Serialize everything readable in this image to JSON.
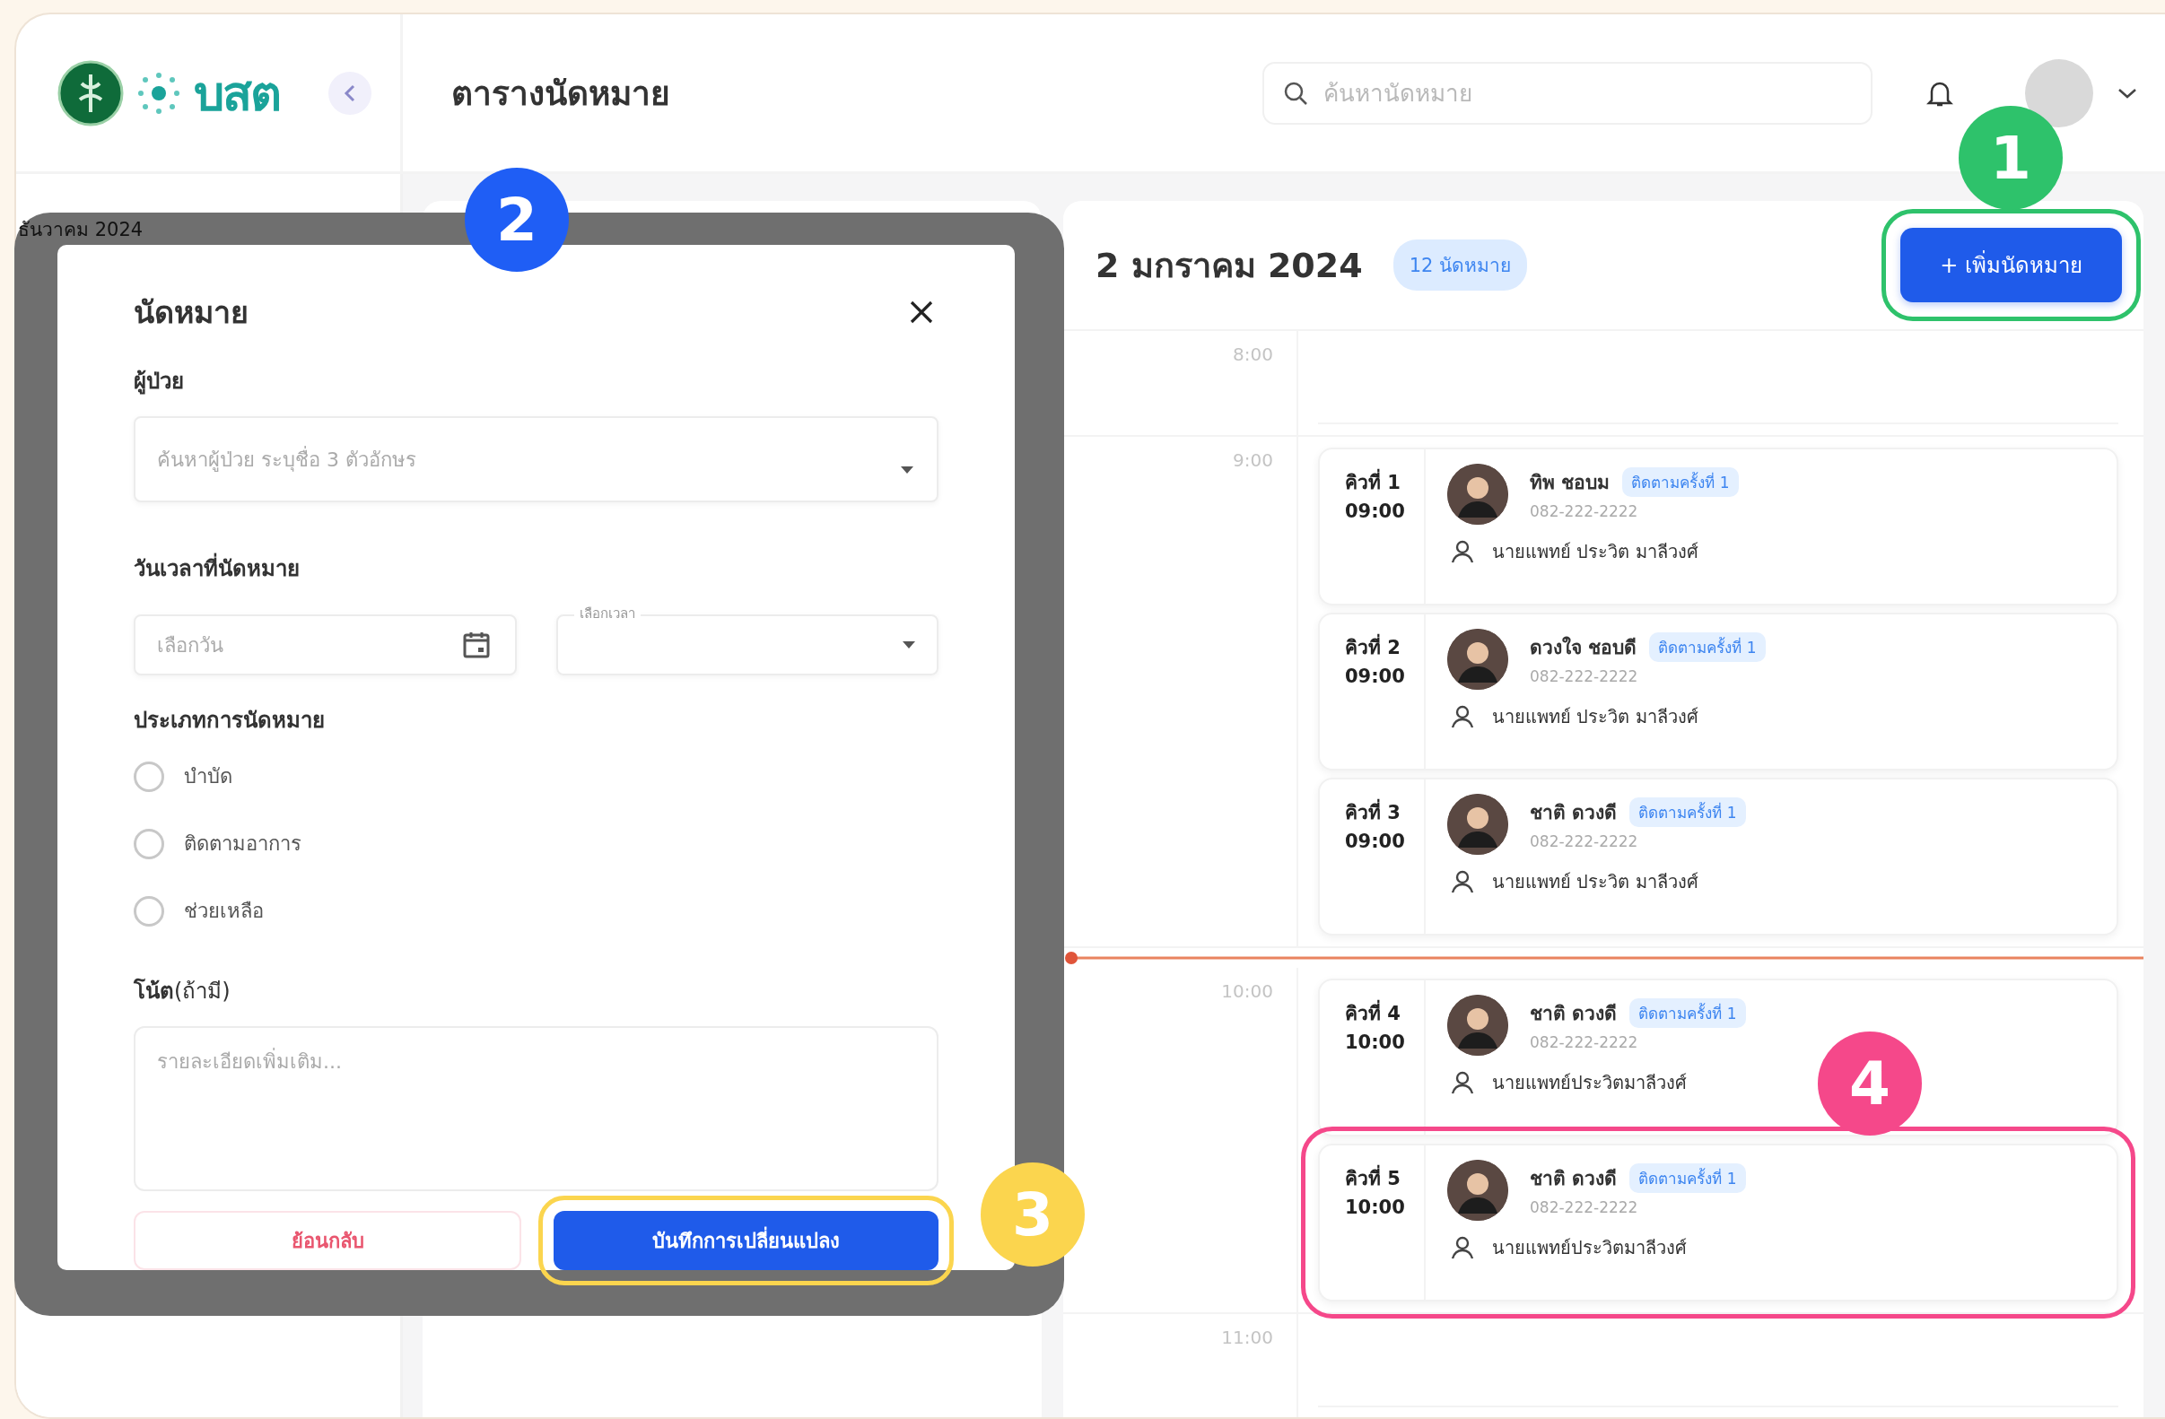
{
  "header": {
    "logo_text": "บสต",
    "page_title": "ตารางนัดหมาย",
    "search": {
      "placeholder": "ค้นหานัดหมาย"
    }
  },
  "sidebar": {
    "month_label": "ธันวาคม 2024"
  },
  "schedule": {
    "date": "2 มกราคม 2024",
    "count_badge": "12 นัดหมาย",
    "add_button": "+ เพิ่มนัดหมาย",
    "slots": [
      {
        "time": "8:00"
      },
      {
        "time": "9:00",
        "appointments": [
          {
            "queue": "คิวที่ 1",
            "time": "09:00",
            "patient": "ทิพ ชอบม",
            "tag": "ติดตามครั้งที่ 1",
            "phone": "082-222-2222",
            "doctor": "นายแพทย์ ประวิต มาลีวงศ์"
          },
          {
            "queue": "คิวที่ 2",
            "time": "09:00",
            "patient": "ดวงใจ ชอบดี",
            "tag": "ติดตามครั้งที่ 1",
            "phone": "082-222-2222",
            "doctor": "นายแพทย์ ประวิต มาลีวงศ์"
          },
          {
            "queue": "คิวที่ 3",
            "time": "09:00",
            "patient": "ชาติ ดวงดี",
            "tag": "ติดตามครั้งที่ 1",
            "phone": "082-222-2222",
            "doctor": "นายแพทย์ ประวิต มาลีวงศ์"
          }
        ]
      },
      {
        "time": "10:00",
        "appointments": [
          {
            "queue": "คิวที่ 4",
            "time": "10:00",
            "patient": "ชาติ ดวงดี",
            "tag": "ติดตามครั้งที่ 1",
            "phone": "082-222-2222",
            "doctor": "นายแพทย์ประวิตมาลีวงศ์"
          },
          {
            "queue": "คิวที่ 5",
            "time": "10:00",
            "patient": "ชาติ ดวงดี",
            "tag": "ติดตามครั้งที่ 1",
            "phone": "082-222-2222",
            "doctor": "นายแพทย์ประวิตมาลีวงศ์"
          }
        ]
      },
      {
        "time": "11:00"
      }
    ]
  },
  "modal": {
    "title": "นัดหมาย",
    "patient_label": "ผู้ป่วย",
    "patient_field": {
      "placeholder": "ค้นหาผู้ป่วย ระบุชื่อ 3 ตัวอักษร"
    },
    "datetime_label": "วันเวลาที่นัดหมาย",
    "date_field": {
      "placeholder": "เลือกวัน"
    },
    "time_field": {
      "label": "เลือกเวลา"
    },
    "type_label": "ประเภทการนัดหมาย",
    "appointment_types": [
      {
        "label": "บำบัด",
        "selected": false
      },
      {
        "label": "ติดตามอาการ",
        "selected": false
      },
      {
        "label": "ช่วยเหลือ",
        "selected": false
      }
    ],
    "note_label": "**โน้ต**(ถ้ามี)",
    "note_field": {
      "placeholder": "รายละเอียดเพิ่มเติม..."
    },
    "back_button": "ย้อนกลับ",
    "save_button": "บันทึกการเปลี่ยนแปลง"
  },
  "annotations": [
    {
      "number": "1",
      "color": "#2ec26b"
    },
    {
      "number": "2",
      "color": "#1f5ef5"
    },
    {
      "number": "3",
      "color": "#fbd54e"
    },
    {
      "number": "4",
      "color": "#f5488a"
    }
  ]
}
